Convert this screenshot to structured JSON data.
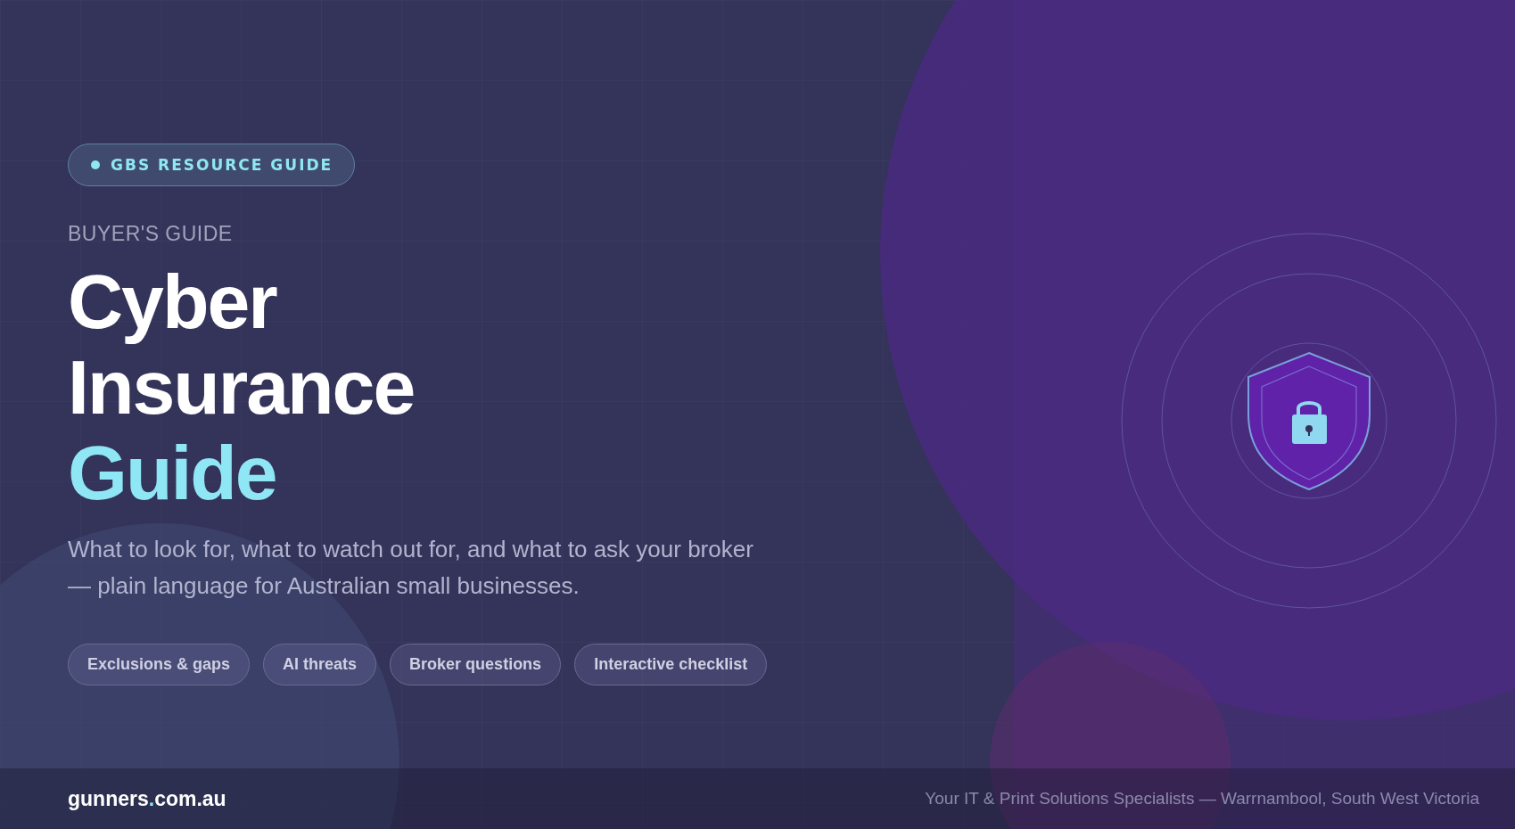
{
  "badge": {
    "label": "GBS RESOURCE GUIDE"
  },
  "eyebrow": "BUYER'S GUIDE",
  "title_lines": [
    {
      "text": "Cyber",
      "accent": false
    },
    {
      "text": "Insurance",
      "accent": false
    },
    {
      "text": "Guide",
      "accent": true
    }
  ],
  "subtitle": "What to look for, what to watch out for, and what to ask your broker — plain language for Australian small businesses.",
  "topics": [
    "Exclusions & gaps",
    "AI threats",
    "Broker questions",
    "Interactive checklist"
  ],
  "footer": {
    "logo": {
      "name": "gunners",
      "dot": ".",
      "domain": "com.au"
    },
    "tagline": "Your IT & Print Solutions Specialists — Warrnambool, South West Victoria"
  }
}
